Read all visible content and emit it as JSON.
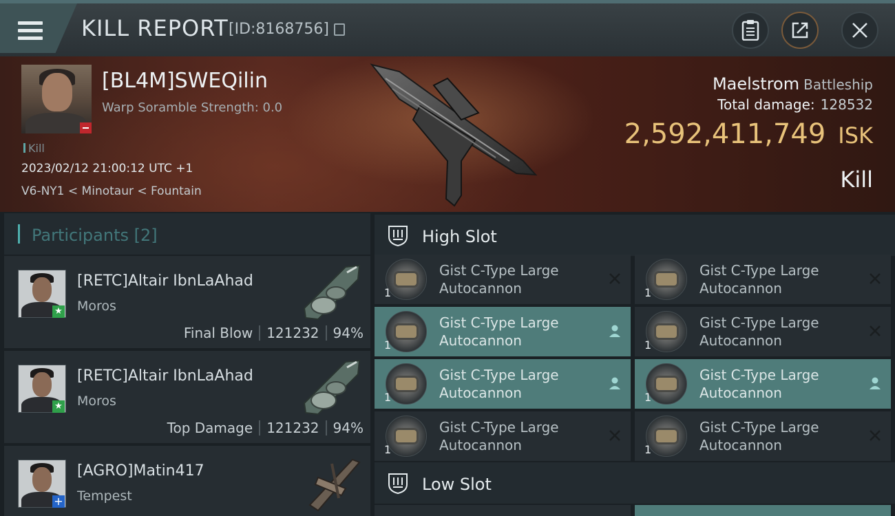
{
  "header": {
    "title": "KILL REPORT",
    "report_id": "[ID:8168756]"
  },
  "victim": {
    "name": "[BL4M]SWEQilin",
    "scramble": "Warp Soramble Strength: 0.0",
    "tag": "Kill",
    "datetime": "2023/02/12 21:00:12 UTC +1",
    "location": "V6-NY1 < Minotaur < Fountain",
    "ship_name": "Maelstrom",
    "ship_class": "Battleship",
    "total_damage_label": "Total damage:",
    "total_damage": "128532",
    "isk_value": "2,592,411,749",
    "isk_unit": "ISK",
    "result": "Kill"
  },
  "participants": {
    "label": "Participants",
    "count": "[2]",
    "items": [
      {
        "name": "[RETC]Altair IbnLaAhad",
        "ship": "Moros",
        "role": "Final Blow",
        "damage": "121232",
        "percent": "94%",
        "badge": "★"
      },
      {
        "name": "[RETC]Altair IbnLaAhad",
        "ship": "Moros",
        "role": "Top Damage",
        "damage": "121232",
        "percent": "94%",
        "badge": "★"
      },
      {
        "name": "[AGRO]Matin417",
        "ship": "Tempest",
        "badge": "+"
      }
    ]
  },
  "slots": {
    "high": {
      "title": "High Slot",
      "modules": [
        {
          "name_line1": "Gist C-Type Large",
          "name_line2": "Autocannon",
          "qty": "1",
          "state": "destroyed"
        },
        {
          "name_line1": "Gist C-Type Large",
          "name_line2": "Autocannon",
          "qty": "1",
          "state": "destroyed"
        },
        {
          "name_line1": "Gist C-Type Large",
          "name_line2": "Autocannon",
          "qty": "1",
          "state": "dropped"
        },
        {
          "name_line1": "Gist C-Type Large",
          "name_line2": "Autocannon",
          "qty": "1",
          "state": "destroyed"
        },
        {
          "name_line1": "Gist C-Type Large",
          "name_line2": "Autocannon",
          "qty": "1",
          "state": "dropped"
        },
        {
          "name_line1": "Gist C-Type Large",
          "name_line2": "Autocannon",
          "qty": "1",
          "state": "dropped"
        },
        {
          "name_line1": "Gist C-Type Large",
          "name_line2": "Autocannon",
          "qty": "1",
          "state": "destroyed"
        },
        {
          "name_line1": "Gist C-Type Large",
          "name_line2": "Autocannon",
          "qty": "1",
          "state": "destroyed"
        }
      ]
    },
    "low": {
      "title": "Low Slot"
    }
  },
  "colors": {
    "accent_teal": "#4fb0ae",
    "isk_gold": "#e8c27a",
    "active_module": "#4f7c7a",
    "loss_red": "#c0272d"
  },
  "icons": [
    "hamburger-menu-icon",
    "copy-icon",
    "clipboard-icon",
    "share-icon",
    "close-icon",
    "high-slot-icon",
    "low-slot-icon",
    "destroyed-x-icon",
    "pilot-icon"
  ]
}
